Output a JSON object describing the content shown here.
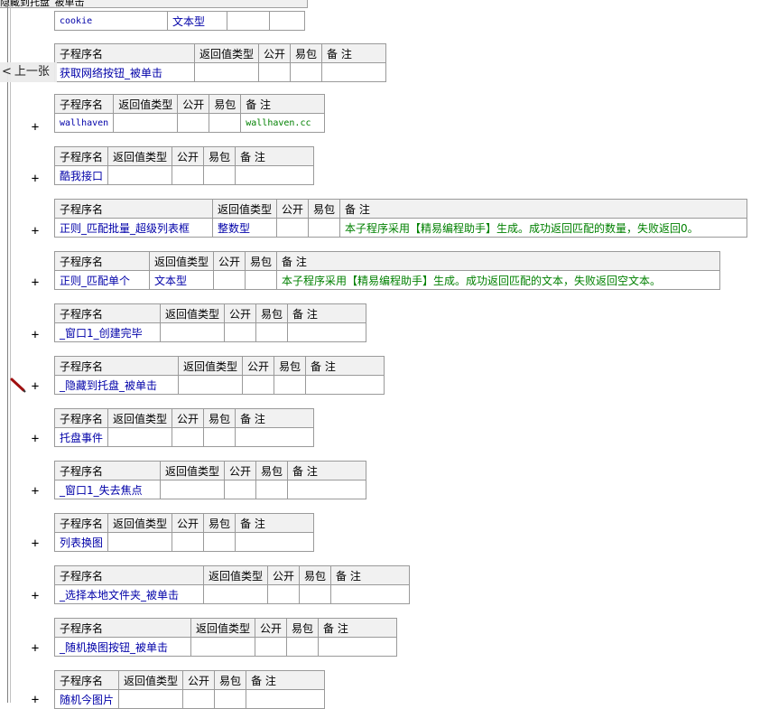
{
  "window_title_fragment": "隐藏到托盘_被单击",
  "nav": {
    "prev_label": "上一张"
  },
  "headers": {
    "name": "子程序名",
    "ret": "返回值类型",
    "public": "公开",
    "easy": "易包",
    "note": "备 注"
  },
  "plus_symbol": "+",
  "top_row": {
    "name": "cookie",
    "type": "文本型"
  },
  "subprograms": [
    {
      "name": "获取网络按钮_被单击",
      "ret": "",
      "note": ""
    },
    {
      "name": "wallhaven",
      "ret": "",
      "note": "wallhaven.cc"
    },
    {
      "name": "酷我接口",
      "ret": "",
      "note": ""
    },
    {
      "name": "正则_匹配批量_超级列表框",
      "ret": "整数型",
      "note": "本子程序采用【精易编程助手】生成。成功返回匹配的数量，失败返回0。"
    },
    {
      "name": "正则_匹配单个",
      "ret": "文本型",
      "note": "本子程序采用【精易编程助手】生成。成功返回匹配的文本，失败返回空文本。"
    },
    {
      "name": "_窗口1_创建完毕",
      "ret": "",
      "note": ""
    },
    {
      "name": "_隐藏到托盘_被单击",
      "ret": "",
      "note": ""
    },
    {
      "name": "托盘事件",
      "ret": "",
      "note": ""
    },
    {
      "name": "_窗口1_失去焦点",
      "ret": "",
      "note": ""
    },
    {
      "name": "列表换图",
      "ret": "",
      "note": ""
    },
    {
      "name": "_选择本地文件夹_被单击",
      "ret": "",
      "note": ""
    },
    {
      "name": "_随机换图按钮_被单击",
      "ret": "",
      "note": ""
    },
    {
      "name": "随机今图片",
      "ret": "",
      "note": ""
    }
  ]
}
